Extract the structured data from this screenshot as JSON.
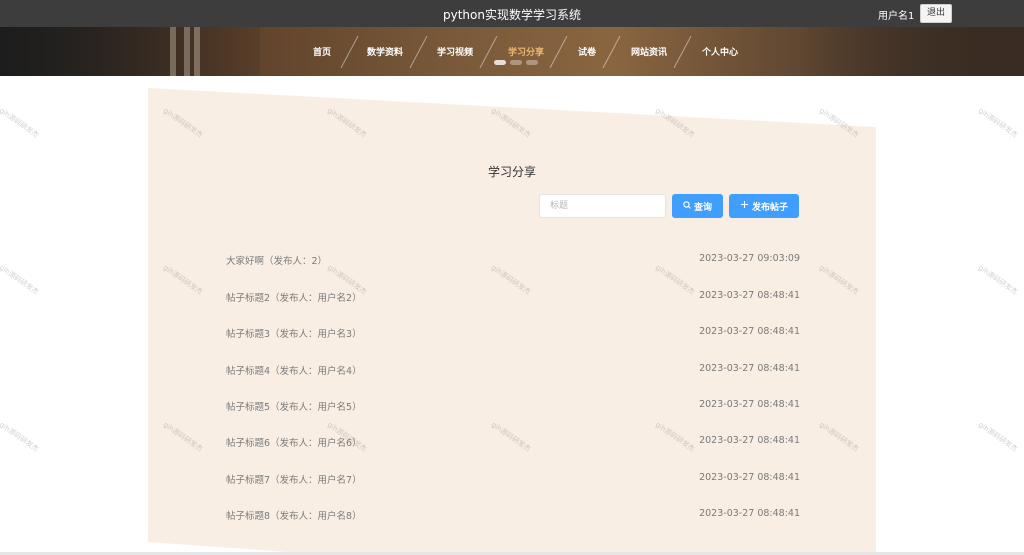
{
  "app": {
    "title": "python实现数学学习系统"
  },
  "user": {
    "name": "用户名1",
    "logout_label": "退出"
  },
  "nav": {
    "items": [
      {
        "label": "首页"
      },
      {
        "label": "数学资料"
      },
      {
        "label": "学习视频"
      },
      {
        "label": "学习分享",
        "active": true
      },
      {
        "label": "试卷"
      },
      {
        "label": "网站资讯"
      },
      {
        "label": "个人中心"
      }
    ]
  },
  "page": {
    "heading": "学习分享"
  },
  "search": {
    "placeholder": "标题",
    "value": "",
    "query_label": "查询",
    "post_label": "发布帖子"
  },
  "posts": [
    {
      "title": "大家好啊（发布人：2）",
      "date": "2023-03-27 09:03:09"
    },
    {
      "title": "帖子标题2（发布人：用户名2）",
      "date": "2023-03-27 08:48:41"
    },
    {
      "title": "帖子标题3（发布人：用户名3）",
      "date": "2023-03-27 08:48:41"
    },
    {
      "title": "帖子标题4（发布人：用户名4）",
      "date": "2023-03-27 08:48:41"
    },
    {
      "title": "帖子标题5（发布人：用户名5）",
      "date": "2023-03-27 08:48:41"
    },
    {
      "title": "帖子标题6（发布人：用户名6）",
      "date": "2023-03-27 08:48:41"
    },
    {
      "title": "帖子标题7（发布人：用户名7）",
      "date": "2023-03-27 08:48:41"
    },
    {
      "title": "帖子标题8（发布人：用户名8）",
      "date": "2023-03-27 08:48:41"
    }
  ],
  "watermark": {
    "text": "gih源码研发杰"
  },
  "icons": {
    "search": "search-icon",
    "plus": "plus-icon"
  },
  "colors": {
    "accent": "#409eff",
    "panel": "#f9eee3",
    "nav_active": "#e8b872",
    "topbar": "#3d3d3d"
  }
}
